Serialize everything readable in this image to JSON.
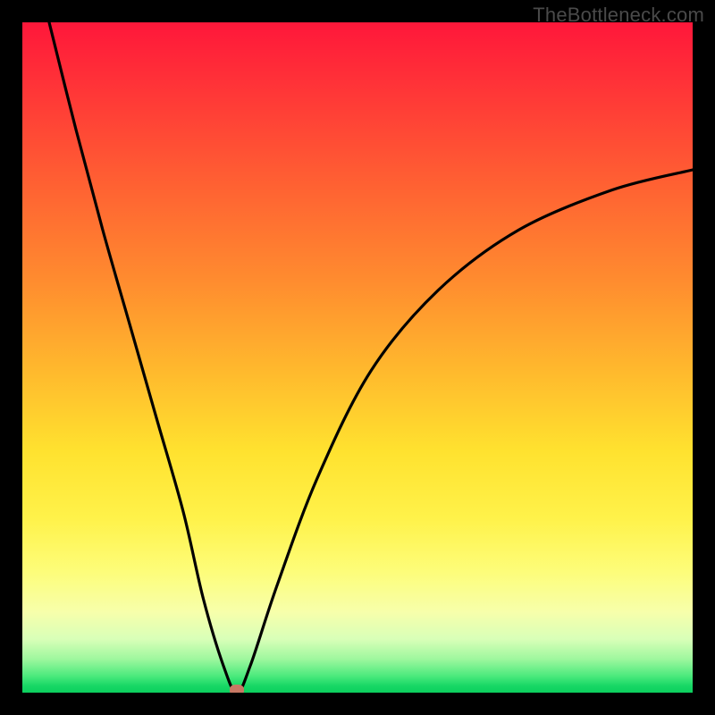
{
  "watermark": "TheBottleneck.com",
  "chart_data": {
    "type": "line",
    "title": "",
    "xlabel": "",
    "ylabel": "",
    "xlim": [
      0,
      100
    ],
    "ylim": [
      0,
      100
    ],
    "grid": false,
    "legend": false,
    "background_gradient": {
      "top": "#ff173a",
      "mid_upper": "#ff8a2f",
      "mid": "#ffe22f",
      "mid_lower": "#fdfd7a",
      "bottom": "#0ccf5e"
    },
    "series": [
      {
        "name": "bottleneck-curve",
        "color": "#000000",
        "x": [
          4,
          8,
          12,
          16,
          20,
          24,
          27,
          30,
          32,
          34,
          38,
          44,
          52,
          62,
          74,
          88,
          100
        ],
        "y": [
          100,
          84,
          69,
          55,
          41,
          27,
          14,
          4,
          0,
          4,
          16,
          32,
          48,
          60,
          69,
          75,
          78
        ]
      }
    ],
    "marker": {
      "name": "min-point",
      "x": 32,
      "y": 0,
      "color": "#c87864"
    }
  }
}
